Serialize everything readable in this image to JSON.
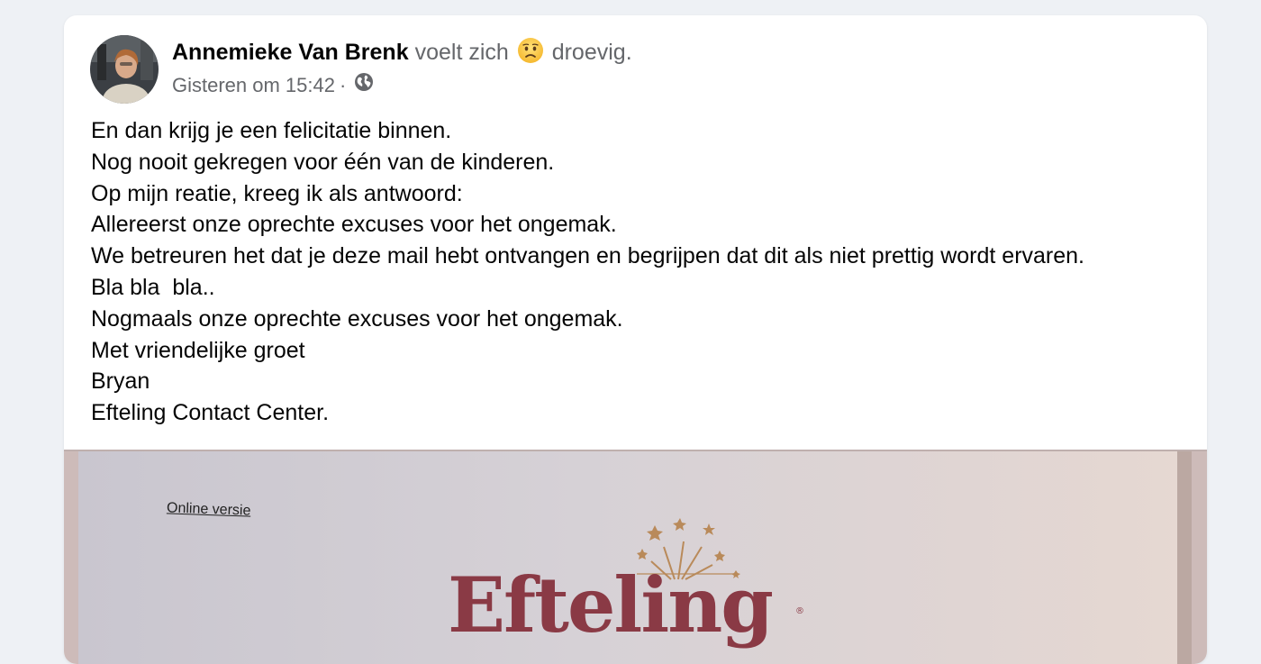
{
  "post": {
    "author": "Annemieke Van Brenk",
    "feeling_prefix": "voelt zich",
    "feeling": "droevig.",
    "feeling_icon": "sad-face-icon",
    "timestamp": "Gisteren om 15:42",
    "separator": "·",
    "audience_icon": "globe-icon",
    "lines": [
      "En dan krijg je een felicitatie binnen.",
      "Nog nooit gekregen voor één van de kinderen.",
      "Op mijn reatie, kreeg ik als antwoord:",
      "Allereerst onze oprechte excuses voor het ongemak.",
      "We betreuren het dat je deze mail hebt ontvangen en begrijpen dat dit als niet prettig wordt ervaren.",
      "Bla bla  bla..",
      "Nogmaals onze oprechte excuses voor het ongemak.",
      "Met vriendelijke groet",
      "Bryan",
      "Efteling Contact Center."
    ]
  },
  "photo": {
    "link_text": "Online versie",
    "logo_text": "Efteling",
    "logo_color": "#8a3a45"
  }
}
